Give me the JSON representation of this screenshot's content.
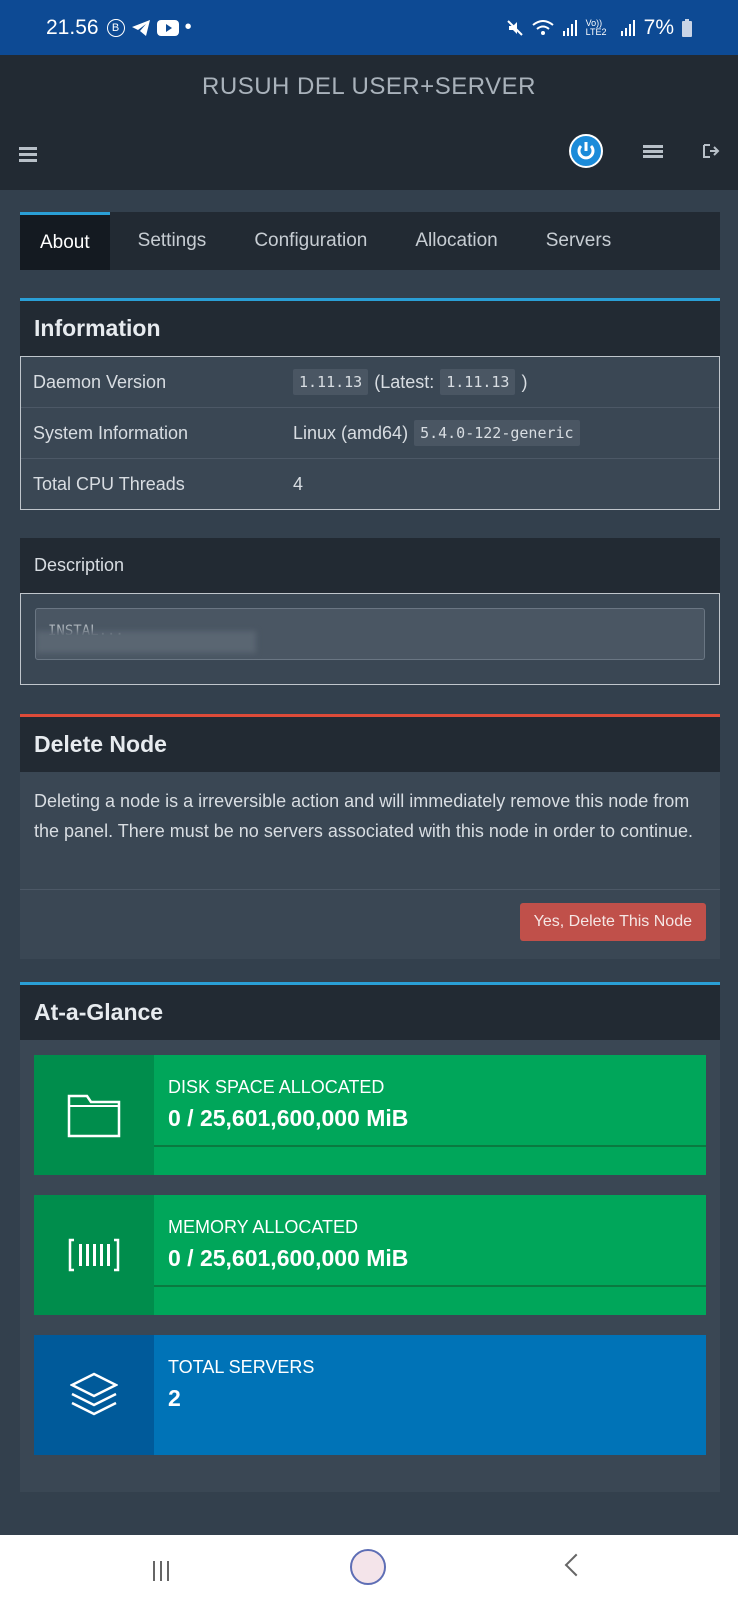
{
  "statusbar": {
    "time": "21.56",
    "battery": "7%",
    "lte_label": "Vo)) LTE2"
  },
  "header": {
    "title": "RUSUH DEL USER+SERVER"
  },
  "tabs": [
    {
      "label": "About",
      "active": true
    },
    {
      "label": "Settings"
    },
    {
      "label": "Configuration"
    },
    {
      "label": "Allocation"
    },
    {
      "label": "Servers"
    }
  ],
  "information": {
    "title": "Information",
    "rows": [
      {
        "key": "Daemon Version",
        "code1": "1.11.13",
        "mid": "(Latest:",
        "code2": "1.11.13",
        "end": ")"
      },
      {
        "key": "System Information",
        "text": "Linux (amd64)",
        "code": "5.4.0-122-generic"
      },
      {
        "key": "Total CPU Threads",
        "text": "4"
      }
    ]
  },
  "description": {
    "title": "Description",
    "value": "INSTAL..."
  },
  "delete_node": {
    "title": "Delete Node",
    "text": "Deleting a node is a irreversible action and will immediately remove this node from the panel. There must be no servers associated with this node in order to continue.",
    "button": "Yes, Delete This Node"
  },
  "glance": {
    "title": "At-a-Glance",
    "stats": [
      {
        "label": "DISK SPACE ALLOCATED",
        "value": "0 / 25,601,600,000 MiB",
        "icon": "folder-icon"
      },
      {
        "label": "MEMORY ALLOCATED",
        "value": "0 / 25,601,600,000 MiB",
        "icon": "memory-icon"
      },
      {
        "label": "TOTAL SERVERS",
        "value": "2",
        "icon": "layers-icon"
      }
    ]
  },
  "colors": {
    "accent": "#2a9fd6",
    "danger": "#dd4b39",
    "success": "#00a65a",
    "info": "#0073b7"
  }
}
